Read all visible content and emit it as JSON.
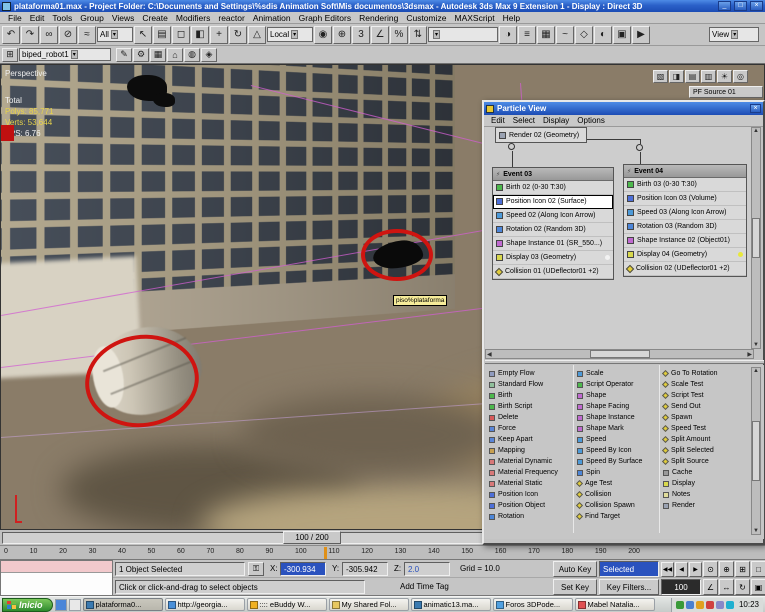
{
  "titlebar": {
    "title": "plataforma01.max - Project Folder: C:\\Documents and Settings\\%sdis Animation Soft\\Mis documentos\\3dsmax - Autodesk 3ds Max 9 Extension 1 - Display : Direct 3D",
    "min": "_",
    "max": "□",
    "close": "×"
  },
  "menubar": {
    "items": [
      "File",
      "Edit",
      "Tools",
      "Group",
      "Views",
      "Create",
      "Modifiers",
      "reactor",
      "Animation",
      "Graph Editors",
      "Rendering",
      "Customize",
      "MAXScript",
      "Help"
    ]
  },
  "toolbar1": {
    "left_icons": [
      {
        "name": "undo-icon",
        "g": "↶"
      },
      {
        "name": "redo-icon",
        "g": "↷"
      },
      {
        "name": "select-and-link-icon",
        "g": "∞"
      },
      {
        "name": "unlink-selection-icon",
        "g": "⊘"
      },
      {
        "name": "bind-to-space-warp-icon",
        "g": "≈"
      }
    ],
    "filter_value": "All",
    "select_icons": [
      {
        "name": "select-object-icon",
        "g": "↖"
      },
      {
        "name": "select-by-name-icon",
        "g": "▤"
      },
      {
        "name": "rectangular-selection-region-icon",
        "g": "◻"
      },
      {
        "name": "window-crossing-icon",
        "g": "◧"
      }
    ],
    "transform_icons": [
      {
        "name": "select-and-move-icon",
        "g": "+"
      },
      {
        "name": "select-and-rotate-icon",
        "g": "↻"
      },
      {
        "name": "select-and-scale-icon",
        "g": "△"
      }
    ],
    "coord_value": "Local",
    "mid_icons": [
      {
        "name": "use-pivot-center-icon",
        "g": "◉"
      },
      {
        "name": "select-and-manipulate-icon",
        "g": "⊕"
      },
      {
        "name": "snaps-toggle-icon",
        "g": "3"
      },
      {
        "name": "angle-snap-icon",
        "g": "∠"
      },
      {
        "name": "percent-snap-icon",
        "g": "%"
      },
      {
        "name": "spinner-snap-icon",
        "g": "⇅"
      }
    ],
    "right_icons": [
      {
        "name": "mirror-icon",
        "g": "◑"
      },
      {
        "name": "align-icon",
        "g": "≡"
      },
      {
        "name": "layer-manager-icon",
        "g": "▦"
      },
      {
        "name": "curve-editor-icon",
        "g": "~"
      },
      {
        "name": "schematic-view-icon",
        "g": "◇"
      },
      {
        "name": "material-editor-icon",
        "g": "◐"
      },
      {
        "name": "render-setup-icon",
        "g": "▣"
      },
      {
        "name": "quick-render-icon",
        "g": "▶"
      }
    ],
    "view_value": "View"
  },
  "toolbar2": {
    "pre_icons": [
      {
        "name": "layout-icon",
        "g": "⊞"
      }
    ],
    "object_value": "biped_robot1",
    "post_icons": [
      {
        "name": "edit-keys-icon",
        "g": "✎"
      },
      {
        "name": "settings-icon",
        "g": "⚙"
      },
      {
        "name": "grid-icon",
        "g": "▦"
      },
      {
        "name": "home-grid-icon",
        "g": "⌂"
      },
      {
        "name": "display-mode-icon",
        "g": "◍"
      },
      {
        "name": "gizmo-icon",
        "g": "◈"
      }
    ]
  },
  "viewport": {
    "label": "Perspective",
    "stats": {
      "total": "Total",
      "polys": "Polys: 85,771",
      "verts": "Verts: 53,644",
      "fps": "FPS: 6.76"
    },
    "tooltip": "piso%plataforma",
    "pf_source": "PF Source 01",
    "overlay_icons": [
      {
        "name": "isolate-icon",
        "g": "▧"
      },
      {
        "name": "display-panel-icon",
        "g": "◨"
      },
      {
        "name": "layers-panel-icon",
        "g": "▤"
      },
      {
        "name": "properties-icon",
        "g": "▥"
      },
      {
        "name": "lights-icon",
        "g": "☀"
      },
      {
        "name": "cameras-icon",
        "g": "◎"
      }
    ]
  },
  "particle_view": {
    "title": "Particle View",
    "close": "×",
    "menu": [
      "Edit",
      "Select",
      "Display",
      "Options"
    ],
    "render_node": {
      "label": "Render 02 (Geometry)",
      "c": "#9aa2b2"
    },
    "events": [
      {
        "title": "Event 03",
        "rows": [
          {
            "label": "Birth 02 (0-30 T:30)",
            "c": "#4db84d"
          },
          {
            "label": "Position Icon 02 (Surface)",
            "c": "#4d6fd8",
            "cls": "sel"
          },
          {
            "label": "Speed 02 (Along Icon Arrow)",
            "c": "#4d9ad8"
          },
          {
            "label": "Rotation 02 (Random 3D)",
            "c": "#4d86d8"
          },
          {
            "label": "Shape Instance 01 (SR_550...)",
            "c": "#c06ad0"
          },
          {
            "label": "Display 03 (Geometry)",
            "c": "#d8d84d",
            "dot": "#f2f2f2"
          },
          {
            "label": "Collision 01 (UDeflector01 +2)",
            "c": "#e0cc3a",
            "cls": "diamond"
          }
        ]
      },
      {
        "title": "Event 04",
        "rows": [
          {
            "label": "Birth 03 (0-30 T:30)",
            "c": "#4db84d"
          },
          {
            "label": "Position Icon 03 (Volume)",
            "c": "#4d6fd8"
          },
          {
            "label": "Speed 03 (Along Icon Arrow)",
            "c": "#4d9ad8"
          },
          {
            "label": "Rotation 03 (Random 3D)",
            "c": "#4d86d8"
          },
          {
            "label": "Shape Instance 02 (Object01)",
            "c": "#c06ad0"
          },
          {
            "label": "Display 04 (Geometry)",
            "c": "#d8d84d",
            "dot": "#e8e83a"
          },
          {
            "label": "Collision 02 (UDeflector01 +2)",
            "c": "#e0cc3a",
            "cls": "diamond"
          }
        ]
      }
    ],
    "depot": {
      "col1": [
        {
          "label": "Empty Flow",
          "c": "#8f9bbf"
        },
        {
          "label": "Standard Flow",
          "c": "#8fbf9b"
        },
        {
          "label": "Birth",
          "c": "#4db84d"
        },
        {
          "label": "Birth Script",
          "c": "#4db84d"
        },
        {
          "label": "Delete",
          "c": "#d85a5a"
        },
        {
          "label": "Force",
          "c": "#5a86d8"
        },
        {
          "label": "Keep Apart",
          "c": "#5a86d8"
        },
        {
          "label": "Mapping",
          "c": "#c8a050"
        },
        {
          "label": "Material Dynamic",
          "c": "#d87878"
        },
        {
          "label": "Material Frequency",
          "c": "#d87878"
        },
        {
          "label": "Material Static",
          "c": "#d87878"
        },
        {
          "label": "Position Icon",
          "c": "#4d6fd8"
        },
        {
          "label": "Position Object",
          "c": "#4d6fd8"
        },
        {
          "label": "Rotation",
          "c": "#4d86d8"
        }
      ],
      "col2": [
        {
          "label": "Scale",
          "c": "#4d9ad8"
        },
        {
          "label": "Script Operator",
          "c": "#4db84d"
        },
        {
          "label": "Shape",
          "c": "#c06ad0"
        },
        {
          "label": "Shape Facing",
          "c": "#c06ad0"
        },
        {
          "label": "Shape Instance",
          "c": "#c06ad0"
        },
        {
          "label": "Shape Mark",
          "c": "#c06ad0"
        },
        {
          "label": "Speed",
          "c": "#4d9ad8"
        },
        {
          "label": "Speed By Icon",
          "c": "#4d9ad8"
        },
        {
          "label": "Speed By Surface",
          "c": "#4d9ad8"
        },
        {
          "label": "Spin",
          "c": "#4d86d8"
        },
        {
          "label": "Age Test",
          "c": "#e0cc3a",
          "cls": "test"
        },
        {
          "label": "Collision",
          "c": "#e0cc3a",
          "cls": "test"
        },
        {
          "label": "Collision Spawn",
          "c": "#e0cc3a",
          "cls": "test"
        },
        {
          "label": "Find Target",
          "c": "#e0cc3a",
          "cls": "test"
        }
      ],
      "col3": [
        {
          "label": "Go To Rotation",
          "c": "#e0cc3a",
          "cls": "test"
        },
        {
          "label": "Scale Test",
          "c": "#e0cc3a",
          "cls": "test"
        },
        {
          "label": "Script Test",
          "c": "#e0cc3a",
          "cls": "test"
        },
        {
          "label": "Send Out",
          "c": "#e0cc3a",
          "cls": "test"
        },
        {
          "label": "Spawn",
          "c": "#e0cc3a",
          "cls": "test"
        },
        {
          "label": "Speed Test",
          "c": "#e0cc3a",
          "cls": "test"
        },
        {
          "label": "Split Amount",
          "c": "#e0cc3a",
          "cls": "test"
        },
        {
          "label": "Split Selected",
          "c": "#e0cc3a",
          "cls": "test"
        },
        {
          "label": "Split Source",
          "c": "#e0cc3a",
          "cls": "test"
        },
        {
          "label": "Cache",
          "c": "#9a9a9a"
        },
        {
          "label": "Display",
          "c": "#d8d84d"
        },
        {
          "label": "Notes",
          "c": "#e0dc9a"
        },
        {
          "label": "Render",
          "c": "#9aa2b2"
        }
      ]
    }
  },
  "timeline": {
    "slider_label": "100 / 200",
    "ticks": [
      "0",
      "10",
      "20",
      "30",
      "40",
      "50",
      "60",
      "70",
      "80",
      "90",
      "100",
      "110",
      "120",
      "130",
      "140",
      "150",
      "160",
      "170",
      "180",
      "190",
      "200"
    ]
  },
  "status": {
    "selection": "1 Object Selected",
    "x_label": "X:",
    "x_value": "-300.934",
    "y_label": "Y:",
    "y_value": "-305.942",
    "z_label": "Z:",
    "z_value": "2.0",
    "grid": "Grid = 10.0",
    "prompt": "Click or click-and-drag to select objects",
    "time_tag": "Add Time Tag",
    "auto_key": "Auto Key",
    "set_key": "Set Key",
    "key_mode": "Selected",
    "key_filters": "Key Filters...",
    "frame": "100",
    "playback": [
      {
        "name": "go-to-start-icon",
        "g": "◀◀"
      },
      {
        "name": "previous-frame-icon",
        "g": "◀"
      },
      {
        "name": "play-icon",
        "g": "▶"
      },
      {
        "name": "next-frame-icon",
        "g": "▶▶"
      }
    ],
    "nav_icons_row1": [
      {
        "name": "zoom-icon",
        "g": "⊙"
      },
      {
        "name": "zoom-all-icon",
        "g": "⊕"
      },
      {
        "name": "zoom-extents-icon",
        "g": "⊞"
      },
      {
        "name": "zoom-extents-all-icon",
        "g": "□"
      }
    ],
    "nav_icons_row2": [
      {
        "name": "field-of-view-icon",
        "g": "∠"
      },
      {
        "name": "pan-icon",
        "g": "↔"
      },
      {
        "name": "arc-rotate-icon",
        "g": "↻"
      },
      {
        "name": "maximize-viewport-toggle-icon",
        "g": "▣"
      }
    ]
  },
  "taskbar": {
    "start": "Inicio",
    "quick": [
      {
        "name": "quick-launch-icon",
        "c": "#4a86d8"
      },
      {
        "name": "quick-launch-icon",
        "c": "#e8e8e8"
      }
    ],
    "items": [
      {
        "label": "plataforma0...",
        "c": "#3a7ab0",
        "cls": "active"
      },
      {
        "label": "http://georgia...",
        "c": "#4a90d8"
      },
      {
        "label": ":::: eBuddy W...",
        "c": "#f0b020"
      },
      {
        "label": "My Shared Fol...",
        "c": "#e8c860"
      },
      {
        "label": "animatic13.ma...",
        "c": "#3a7ab0"
      },
      {
        "label": "Foros 3DPode...",
        "c": "#50a0e0"
      },
      {
        "label": "Mabel Natalia...",
        "c": "#e05050"
      }
    ],
    "tray": [
      {
        "name": "tray-icon",
        "c": "#3a9a3a"
      },
      {
        "name": "tray-icon",
        "c": "#4a80d0"
      },
      {
        "name": "tray-icon",
        "c": "#e0a020"
      },
      {
        "name": "tray-icon",
        "c": "#d04040"
      },
      {
        "name": "tray-icon",
        "c": "#8888c8"
      },
      {
        "name": "tray-icon",
        "c": "#20b0d0"
      }
    ],
    "clock": "10:23"
  }
}
